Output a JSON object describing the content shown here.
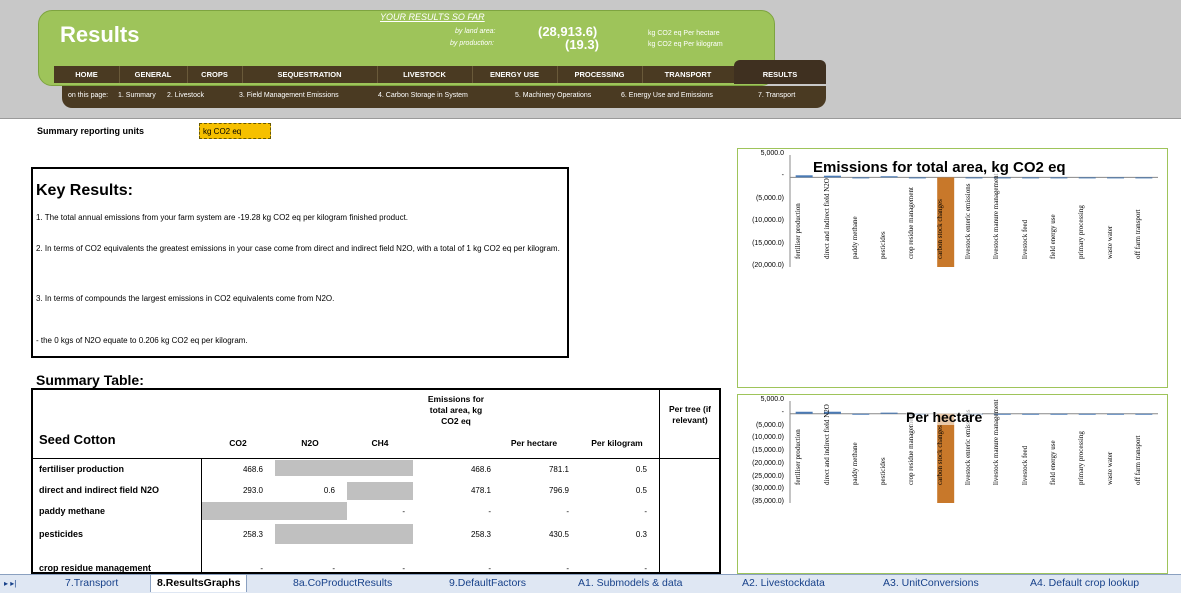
{
  "header": {
    "title": "Results",
    "your_results": "YOUR RESULTS SO FAR",
    "by_land_area": "by land area:",
    "by_production": "by production:",
    "land_area_value": "(28,913.6)",
    "production_value": "(19.3)",
    "land_area_unit": "kg CO2 eq  Per hectare",
    "production_unit": "kg CO2 eq  Per kilogram"
  },
  "nav": {
    "items": [
      "HOME",
      "GENERAL",
      "CROPS",
      "SEQUESTRATION",
      "LIVESTOCK",
      "ENERGY USE",
      "PROCESSING",
      "TRANSPORT"
    ],
    "active": "RESULTS"
  },
  "subnav": {
    "label": "on this page:",
    "items": [
      "1. Summary",
      "2. Livestock",
      "3. Field Management  Emissions",
      "4. Carbon Storage  in System",
      "5. Machinery  Operations",
      "6. Energy Use and  Emissions",
      "7. Transport"
    ]
  },
  "reporting": {
    "label": "Summary reporting units",
    "value": "kg CO2 eq"
  },
  "key_results": {
    "title": "Key Results:",
    "lines": [
      "1. The total annual emissions from your farm system are -19.28 kg CO2 eq per kilogram finished product.",
      "2. In terms of CO2 equivalents the greatest emissions in your case come from direct and indirect field N2O, with a total of 1 kg CO2 eq per kilogram.",
      "3. In terms of compounds the largest emissions in CO2 equivalents come from N2O.",
      " - the 0 kgs of N2O equate to 0.206 kg CO2 eq per kilogram."
    ]
  },
  "summary_table": {
    "title": "Summary Table:",
    "crop": "Seed Cotton",
    "headers": [
      "CO2",
      "N2O",
      "CH4",
      "Emissions for total area, kg CO2 eq",
      "Per hectare",
      "Per kilogram",
      "Per tree (if relevant)"
    ],
    "rows": [
      {
        "label": "fertiliser production",
        "co2": "468.6",
        "n2o": "",
        "ch4": "",
        "total": "468.6",
        "per_ha": "781.1",
        "per_kg": "0.5"
      },
      {
        "label": "direct and indirect field N2O",
        "co2": "293.0",
        "n2o": "0.6",
        "ch4": "",
        "total": "478.1",
        "per_ha": "796.9",
        "per_kg": "0.5"
      },
      {
        "label": "paddy methane",
        "co2": "",
        "n2o": "",
        "ch4": "-",
        "total": "-",
        "per_ha": "-",
        "per_kg": "-"
      },
      {
        "label": "pesticides",
        "co2": "258.3",
        "n2o": "",
        "ch4": "",
        "total": "258.3",
        "per_ha": "430.5",
        "per_kg": "0.3"
      },
      {
        "label": "crop residue management",
        "co2": "-",
        "n2o": "-",
        "ch4": "-",
        "total": "-",
        "per_ha": "-",
        "per_kg": "-"
      }
    ]
  },
  "chart_data": [
    {
      "type": "bar",
      "title": "Emissions for total area, kg CO2 eq",
      "categories": [
        "fertiliser production",
        "direct and indirect field N2O",
        "paddy methane",
        "pesticides",
        "crop residue management",
        "carbon stock changes",
        "livestock enteric emissions",
        "livestock manure management",
        "livestock feed",
        "field energy use",
        "primary processing",
        "waste water",
        "off farm transport"
      ],
      "values": [
        469,
        478,
        0,
        258,
        0,
        -20000,
        0,
        0,
        0,
        0,
        0,
        0,
        0
      ],
      "ylim": [
        -20000,
        5000
      ],
      "yticks": [
        "5,000.0",
        "-",
        "(5,000.0)",
        "(10,000.0)",
        "(15,000.0)",
        "(20,000.0)"
      ],
      "bar_color": "#c8782a"
    },
    {
      "type": "bar",
      "title": "Per hectare",
      "categories": [
        "fertiliser production",
        "direct and indirect field N2O",
        "paddy methane",
        "pesticides",
        "crop residue management",
        "carbon stock changes",
        "livestock enteric emissions",
        "livestock manure management",
        "livestock feed",
        "field energy use",
        "primary processing",
        "waste water",
        "off farm transport"
      ],
      "values": [
        781,
        797,
        0,
        431,
        0,
        -35000,
        0,
        0,
        0,
        0,
        0,
        0,
        0
      ],
      "ylim": [
        -35000,
        5000
      ],
      "yticks": [
        "5,000.0",
        "-",
        "(5,000.0)",
        "(10,000.0)",
        "(15,000.0)",
        "(20,000.0)",
        "(25,000.0)",
        "(30,000.0)",
        "(35,000.0)"
      ],
      "bar_color": "#c8782a"
    }
  ],
  "sheet_tabs": {
    "nav": "▸ ▸|",
    "items": [
      "7.Transport",
      "8.ResultsGraphs",
      "8a.CoProductResults",
      "9.DefaultFactors",
      "A1. Submodels & data",
      "A2. Livestockdata",
      "A3. UnitConversions",
      "A4. Default crop lookup"
    ],
    "active": "8.ResultsGraphs"
  }
}
